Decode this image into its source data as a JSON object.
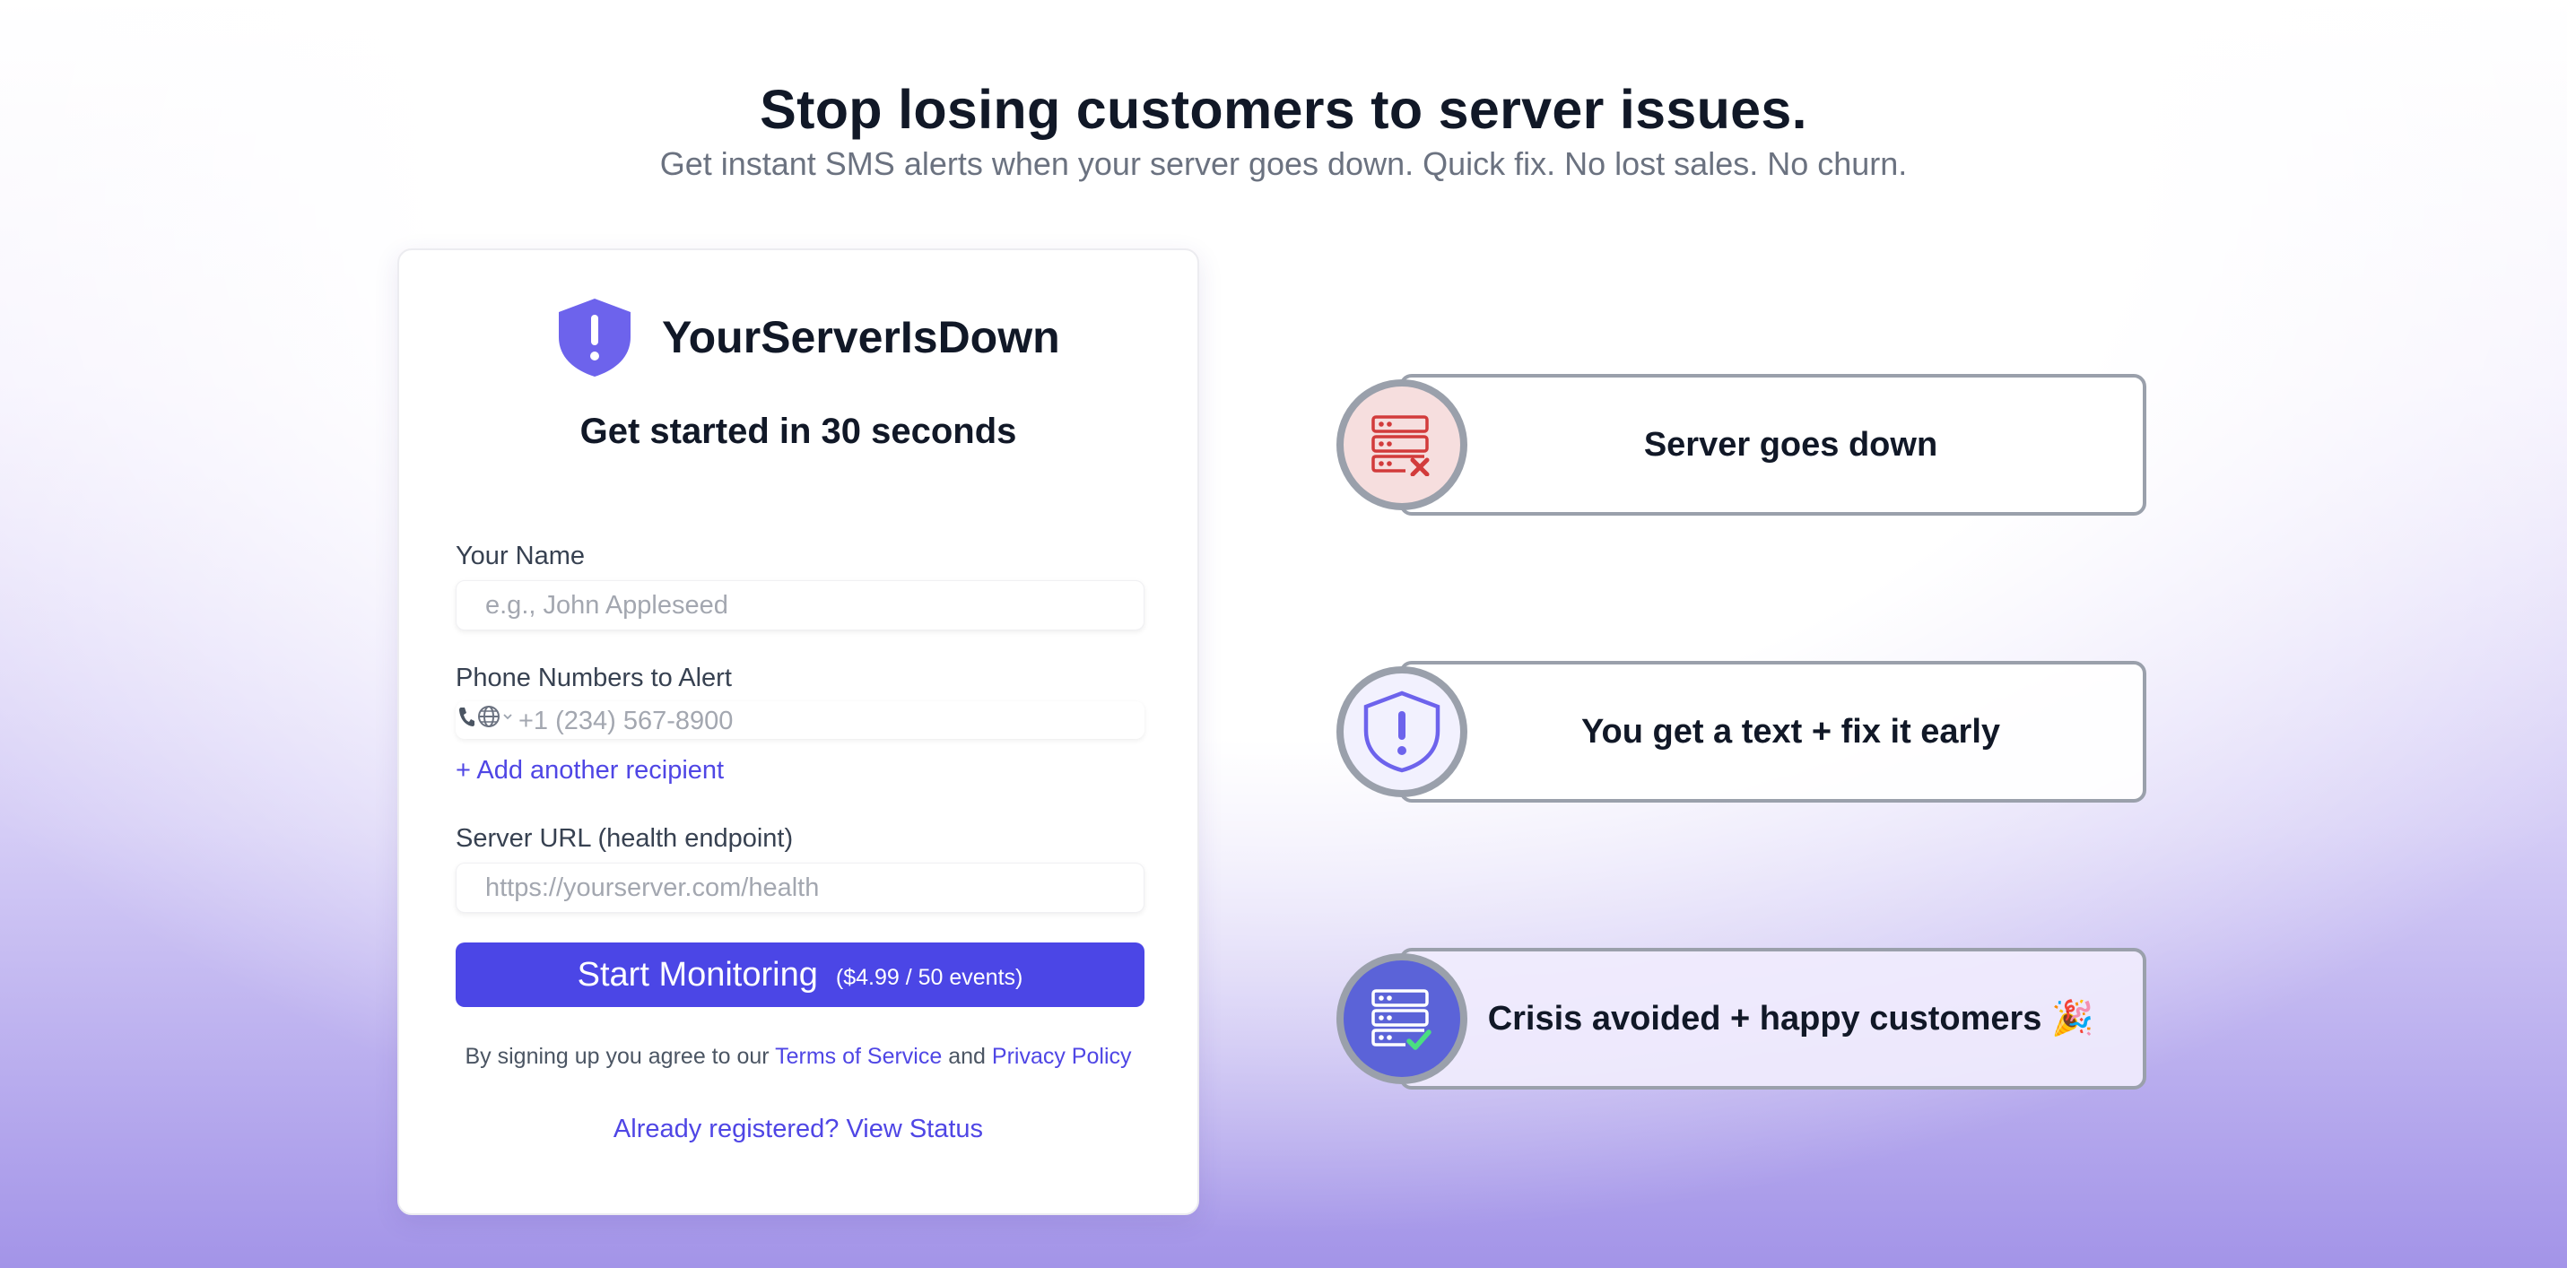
{
  "hero": {
    "title": "Stop losing customers to server issues.",
    "subtitle": "Get instant SMS alerts when your server goes down. Quick fix. No lost sales. No churn."
  },
  "signup": {
    "brand_name": "YourServerIsDown",
    "brand_icon": "shield-alert-icon",
    "title": "Get started in 30 seconds",
    "name_label": "Your Name",
    "name_placeholder": "e.g., John Appleseed",
    "phone_label": "Phone Numbers to Alert",
    "phone_placeholder": "+1 (234) 567-8900",
    "add_recipient": "+ Add another recipient",
    "url_label": "Server URL (health endpoint)",
    "url_placeholder": "https://yourserver.com/health",
    "submit_label": "Start Monitoring",
    "submit_price": "($4.99 / 50 events)",
    "legal_prefix": "By signing up you agree to our",
    "terms_link": "Terms of Service",
    "legal_and": "and",
    "privacy_link": "Privacy Policy",
    "status_link": "Already registered? View Status"
  },
  "steps": [
    {
      "label": "Server goes down",
      "icon": "server-down-icon"
    },
    {
      "label": "You get a text + fix it early",
      "icon": "shield-alert-icon"
    },
    {
      "label": "Crisis avoided + happy customers 🎉",
      "icon": "server-check-icon"
    }
  ],
  "colors": {
    "accent": "#4b46e6",
    "link": "#4f46e5",
    "brand_icon": "#6d63ec",
    "step_border": "#9aa0ab",
    "danger": "#d23b3b",
    "success": "#4ade80"
  }
}
